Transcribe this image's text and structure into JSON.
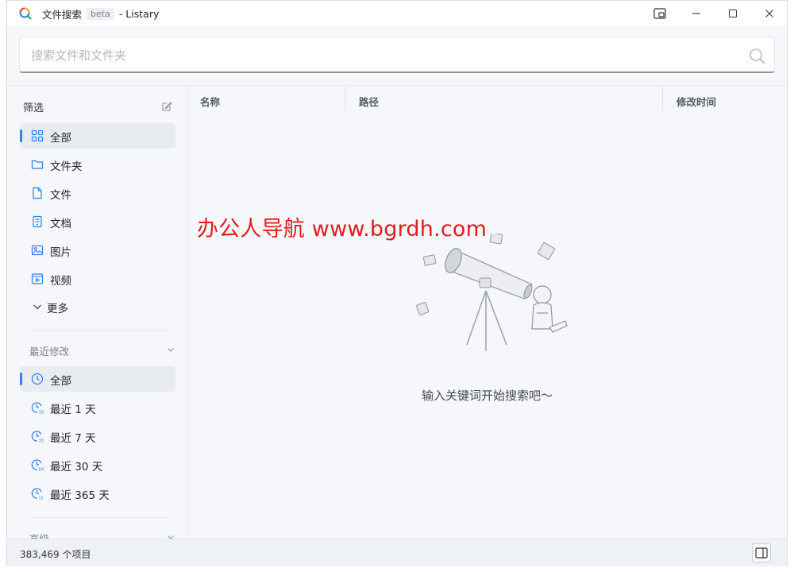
{
  "window": {
    "title": "文件搜索",
    "badge": "beta",
    "app_name": "- Listary"
  },
  "search": {
    "placeholder": "搜索文件和文件夹",
    "value": ""
  },
  "sidebar": {
    "filter_title": "筛选",
    "type_items": [
      {
        "label": "全部",
        "icon": "grid-icon",
        "active": true
      },
      {
        "label": "文件夹",
        "icon": "folder-icon"
      },
      {
        "label": "文件",
        "icon": "file-icon"
      },
      {
        "label": "文档",
        "icon": "document-icon"
      },
      {
        "label": "图片",
        "icon": "image-icon"
      },
      {
        "label": "视频",
        "icon": "video-icon"
      },
      {
        "label": "更多",
        "icon": "chevron-down-icon"
      }
    ],
    "recent_title": "最近修改",
    "recent_items": [
      {
        "label": "全部",
        "icon": "clock-icon",
        "active": true
      },
      {
        "label": "最近 1 天",
        "icon": "clock-1d-icon",
        "sub": "1D"
      },
      {
        "label": "最近 7 天",
        "icon": "clock-7d-icon",
        "sub": "7D"
      },
      {
        "label": "最近 30 天",
        "icon": "clock-1m-icon",
        "sub": "1M"
      },
      {
        "label": "最近 365 天",
        "icon": "clock-1y-icon",
        "sub": "1Y"
      }
    ],
    "advanced_title": "高级"
  },
  "columns": {
    "name": "名称",
    "path": "路径",
    "modified": "修改时间"
  },
  "empty_state": {
    "message": "输入关键词开始搜索吧～"
  },
  "watermark": "办公人导航 www.bgrdh.com",
  "status": {
    "count": "383,469 个项目"
  },
  "colors": {
    "accent": "#2f7ff0",
    "watermark": "#e11d1d",
    "sidebar_bg": "#f5f7fa"
  }
}
